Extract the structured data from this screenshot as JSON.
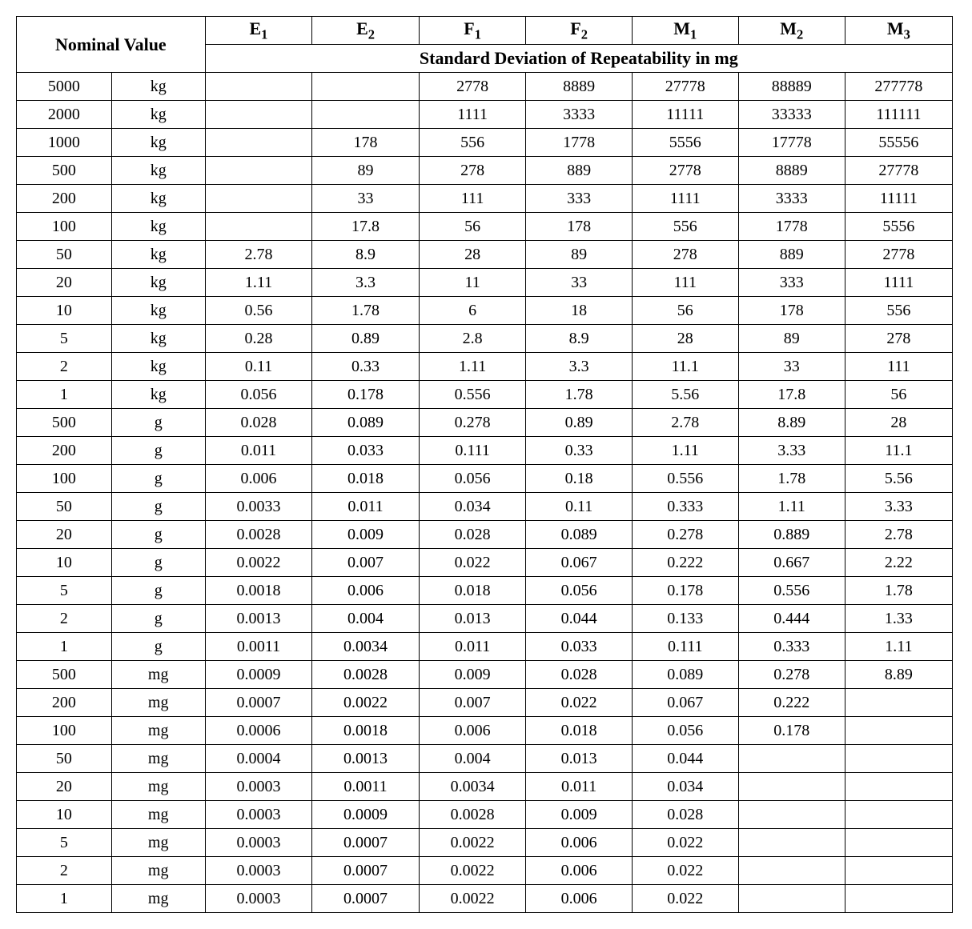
{
  "headers": {
    "nominal": "Nominal Value",
    "classes": [
      {
        "base": "E",
        "sub": "1"
      },
      {
        "base": "E",
        "sub": "2"
      },
      {
        "base": "F",
        "sub": "1"
      },
      {
        "base": "F",
        "sub": "2"
      },
      {
        "base": "M",
        "sub": "1"
      },
      {
        "base": "M",
        "sub": "2"
      },
      {
        "base": "M",
        "sub": "3"
      }
    ],
    "subheader": "Standard Deviation of Repeatability in mg"
  },
  "rows": [
    {
      "value": "5000",
      "unit": "kg",
      "cells": [
        "",
        "",
        "2778",
        "8889",
        "27778",
        "88889",
        "277778"
      ]
    },
    {
      "value": "2000",
      "unit": "kg",
      "cells": [
        "",
        "",
        "1111",
        "3333",
        "11111",
        "33333",
        "111111"
      ]
    },
    {
      "value": "1000",
      "unit": "kg",
      "cells": [
        "",
        "178",
        "556",
        "1778",
        "5556",
        "17778",
        "55556"
      ]
    },
    {
      "value": "500",
      "unit": "kg",
      "cells": [
        "",
        "89",
        "278",
        "889",
        "2778",
        "8889",
        "27778"
      ]
    },
    {
      "value": "200",
      "unit": "kg",
      "cells": [
        "",
        "33",
        "111",
        "333",
        "1111",
        "3333",
        "11111"
      ]
    },
    {
      "value": "100",
      "unit": "kg",
      "cells": [
        "",
        "17.8",
        "56",
        "178",
        "556",
        "1778",
        "5556"
      ]
    },
    {
      "value": "50",
      "unit": "kg",
      "cells": [
        "2.78",
        "8.9",
        "28",
        "89",
        "278",
        "889",
        "2778"
      ]
    },
    {
      "value": "20",
      "unit": "kg",
      "cells": [
        "1.11",
        "3.3",
        "11",
        "33",
        "111",
        "333",
        "1111"
      ]
    },
    {
      "value": "10",
      "unit": "kg",
      "cells": [
        "0.56",
        "1.78",
        "6",
        "18",
        "56",
        "178",
        "556"
      ]
    },
    {
      "value": "5",
      "unit": "kg",
      "cells": [
        "0.28",
        "0.89",
        "2.8",
        "8.9",
        "28",
        "89",
        "278"
      ]
    },
    {
      "value": "2",
      "unit": "kg",
      "cells": [
        "0.11",
        "0.33",
        "1.11",
        "3.3",
        "11.1",
        "33",
        "111"
      ]
    },
    {
      "value": "1",
      "unit": "kg",
      "cells": [
        "0.056",
        "0.178",
        "0.556",
        "1.78",
        "5.56",
        "17.8",
        "56"
      ]
    },
    {
      "value": "500",
      "unit": "g",
      "cells": [
        "0.028",
        "0.089",
        "0.278",
        "0.89",
        "2.78",
        "8.89",
        "28"
      ]
    },
    {
      "value": "200",
      "unit": "g",
      "cells": [
        "0.011",
        "0.033",
        "0.111",
        "0.33",
        "1.11",
        "3.33",
        "11.1"
      ]
    },
    {
      "value": "100",
      "unit": "g",
      "cells": [
        "0.006",
        "0.018",
        "0.056",
        "0.18",
        "0.556",
        "1.78",
        "5.56"
      ]
    },
    {
      "value": "50",
      "unit": "g",
      "cells": [
        "0.0033",
        "0.011",
        "0.034",
        "0.11",
        "0.333",
        "1.11",
        "3.33"
      ]
    },
    {
      "value": "20",
      "unit": "g",
      "cells": [
        "0.0028",
        "0.009",
        "0.028",
        "0.089",
        "0.278",
        "0.889",
        "2.78"
      ]
    },
    {
      "value": "10",
      "unit": "g",
      "cells": [
        "0.0022",
        "0.007",
        "0.022",
        "0.067",
        "0.222",
        "0.667",
        "2.22"
      ]
    },
    {
      "value": "5",
      "unit": "g",
      "cells": [
        "0.0018",
        "0.006",
        "0.018",
        "0.056",
        "0.178",
        "0.556",
        "1.78"
      ]
    },
    {
      "value": "2",
      "unit": "g",
      "cells": [
        "0.0013",
        "0.004",
        "0.013",
        "0.044",
        "0.133",
        "0.444",
        "1.33"
      ]
    },
    {
      "value": "1",
      "unit": "g",
      "cells": [
        "0.0011",
        "0.0034",
        "0.011",
        "0.033",
        "0.111",
        "0.333",
        "1.11"
      ]
    },
    {
      "value": "500",
      "unit": "mg",
      "cells": [
        "0.0009",
        "0.0028",
        "0.009",
        "0.028",
        "0.089",
        "0.278",
        "8.89"
      ]
    },
    {
      "value": "200",
      "unit": "mg",
      "cells": [
        "0.0007",
        "0.0022",
        "0.007",
        "0.022",
        "0.067",
        "0.222",
        ""
      ]
    },
    {
      "value": "100",
      "unit": "mg",
      "cells": [
        "0.0006",
        "0.0018",
        "0.006",
        "0.018",
        "0.056",
        "0.178",
        ""
      ]
    },
    {
      "value": "50",
      "unit": "mg",
      "cells": [
        "0.0004",
        "0.0013",
        "0.004",
        "0.013",
        "0.044",
        "",
        ""
      ]
    },
    {
      "value": "20",
      "unit": "mg",
      "cells": [
        "0.0003",
        "0.0011",
        "0.0034",
        "0.011",
        "0.034",
        "",
        ""
      ]
    },
    {
      "value": "10",
      "unit": "mg",
      "cells": [
        "0.0003",
        "0.0009",
        "0.0028",
        "0.009",
        "0.028",
        "",
        ""
      ]
    },
    {
      "value": "5",
      "unit": "mg",
      "cells": [
        "0.0003",
        "0.0007",
        "0.0022",
        "0.006",
        "0.022",
        "",
        ""
      ]
    },
    {
      "value": "2",
      "unit": "mg",
      "cells": [
        "0.0003",
        "0.0007",
        "0.0022",
        "0.006",
        "0.022",
        "",
        ""
      ]
    },
    {
      "value": "1",
      "unit": "mg",
      "cells": [
        "0.0003",
        "0.0007",
        "0.0022",
        "0.006",
        "0.022",
        "",
        ""
      ]
    }
  ]
}
